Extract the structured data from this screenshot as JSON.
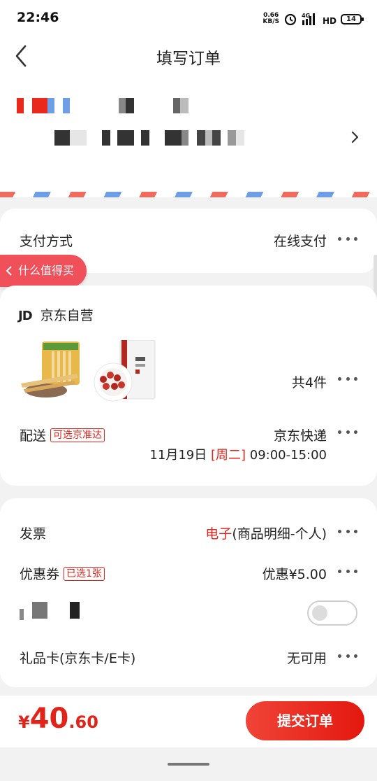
{
  "status_bar": {
    "time": "22:46",
    "net_speed_value": "0.66",
    "net_speed_unit": "KB/S",
    "network": "4G",
    "hd": "HD",
    "battery": "14",
    "icons": [
      "alarm-icon",
      "signal-icon",
      "hd-icon",
      "battery-icon"
    ]
  },
  "header": {
    "title": "填写订单",
    "back_icon": "back-arrow-icon"
  },
  "address": {
    "arrow_icon": "chevron-right-icon",
    "stripe_colors": [
      "#ee6b5e",
      "#6d9ee6"
    ]
  },
  "payment": {
    "label": "支付方式",
    "value": "在线支付"
  },
  "floating_pill": {
    "label": "什么值得买"
  },
  "shop": {
    "logo": "JD",
    "name": "京东自营",
    "item_count": "共4件",
    "delivery_label": "配送",
    "delivery_tag": "可选京准达",
    "delivery_method": "京东快递",
    "delivery_date": "11月19日",
    "delivery_weekday": "[周二]",
    "delivery_window": "09:00-15:00"
  },
  "invoice": {
    "label": "发票",
    "value_type": "电子",
    "value_detail": "(商品明细-个人)"
  },
  "coupon": {
    "label": "优惠券",
    "tag": "已选1张",
    "value": "优惠¥5.00"
  },
  "gift_card": {
    "label": "礼品卡(京东卡/E卡)",
    "value": "无可用"
  },
  "footer": {
    "currency": "¥",
    "price_int": "40",
    "price_dec": ".60",
    "submit_label": "提交订单"
  },
  "colors": {
    "accent": "#e2231a",
    "pill": "#f0505a",
    "background": "#f2f2f2"
  }
}
